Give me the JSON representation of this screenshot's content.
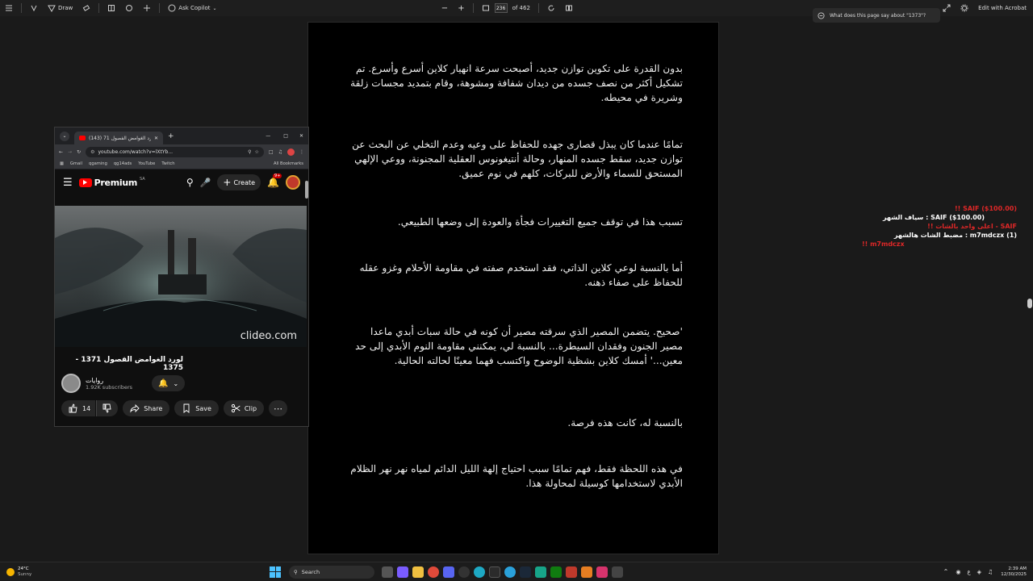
{
  "toolbar": {
    "draw_label": "Draw",
    "ask_copilot_label": "Ask Copilot",
    "page_number": "236",
    "page_total": "of 462",
    "edit_label": "Edit with Acrobat"
  },
  "ai_prompt": {
    "text": "What does this page say about \"1373\"?"
  },
  "document": {
    "paragraphs": [
      "بدون القدرة على تكوين توازن جديد، أصبحت سرعة انهيار كلاين أسرع وأسرع. تم تشكيل أكثر من نصف جسده من ديدان شفافة ومشوهة، وقام بتمديد مجسات زلقة وشريرة في محيطه.",
      "تمامًا عندما كان يبذل قصارى جهده للحفاظ على وعيه وعدم التخلي عن البحث عن توازن جديد، سقط جسده المنهار، وحالة أنتيغونوس العقلية المجنونة، ووعي الإلهي المستحق للسماء والأرض للبركات، كلهم في نوم عميق.",
      "تسبب هذا في توقف جميع التغييرات فجأة والعودة إلى وضعها الطبيعي.",
      "أما بالنسبة لوعي كلاين الذاتي، فقد استخدم صفته في مقاومة الأحلام وغزو عقله للحفاظ على صفاء ذهنه.",
      "'صحيح. يتضمن المصير الذي سرقته مصير أن كونه في حالة سبات أبدي ماعدا مصير الجنون وفقدان السيطرة... بالنسبة لي، يمكنني مقاومة النوم الأبدي إلى حد معين...' أمسك كلاين بشظية الوضوح واكتسب فهما معينًا لحالته الحالية.",
      "بالنسبة له، كانت هذه فرصة.",
      "في هذه اللحظة فقط، فهم تمامًا سبب احتياج إلهة الليل الدائم لمياه نهر نهر الظلام الأبدي لاستخدامها كوسيلة لمحاولة هذا."
    ]
  },
  "overlay": {
    "line1": "!! SAIF ($100.00)",
    "line2": "سياف الشهر : SAIF ($100.00)",
    "line3": "!! اعلى واحد بالشات - SAIF",
    "line4": "مضبط الشات هالشهر : m7mdczx (1)",
    "line5": "!! m7mdczx"
  },
  "browser": {
    "tab_count": "(143)",
    "tab_title": "(143) لورد الغوامض الفصول 71",
    "url": "youtube.com/watch?v=lXtYb...",
    "bookmarks": [
      "Gmail",
      "qgaming",
      "qg14ads",
      "YouTube",
      "Twitch"
    ],
    "all_bookmarks": "All Bookmarks"
  },
  "youtube": {
    "logo_text": "Premium",
    "logo_region": "SA",
    "create_label": "Create",
    "notif_count": "9+",
    "watermark": "clideo.com",
    "video_title": "لورد الغوامض الفصول 1371 - 1375",
    "channel_name": "روايات",
    "subscribers": "1.92K subscribers",
    "like_count": "14",
    "share_label": "Share",
    "save_label": "Save",
    "clip_label": "Clip"
  },
  "taskbar": {
    "temperature": "24°C",
    "weather": "Sunny",
    "search_placeholder": "Search",
    "time": "2:39 AM",
    "date": "12/30/2025"
  },
  "colors": {
    "youtube_red": "#ff0000",
    "overlay_red": "#ff2a2a"
  }
}
